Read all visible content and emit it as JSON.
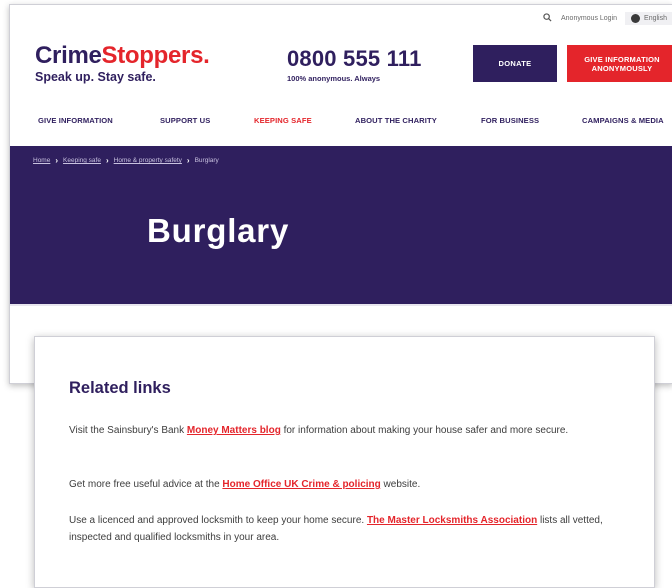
{
  "utility": {
    "login": "Anonymous Login",
    "language": "English"
  },
  "brand": {
    "name_part1": "Crime",
    "name_part2": "Stoppers.",
    "tagline": "Speak up. Stay safe.",
    "primary_color": "#2f1f5e",
    "accent_color": "#e4252b"
  },
  "phone": {
    "number": "0800 555 111",
    "subtitle": "100% anonymous. Always"
  },
  "buttons": {
    "donate": "DONATE",
    "give_info": "GIVE INFORMATION ANONYMOUSLY"
  },
  "nav": {
    "items": [
      {
        "label": "GIVE INFORMATION",
        "active": false
      },
      {
        "label": "SUPPORT US",
        "active": false
      },
      {
        "label": "KEEPING SAFE",
        "active": true
      },
      {
        "label": "ABOUT THE CHARITY",
        "active": false
      },
      {
        "label": "FOR BUSINESS",
        "active": false
      },
      {
        "label": "CAMPAIGNS & MEDIA",
        "active": false
      }
    ]
  },
  "breadcrumb": {
    "items": [
      "Home",
      "Keeping safe",
      "Home & property safety",
      "Burglary"
    ]
  },
  "page": {
    "title": "Burglary"
  },
  "related": {
    "heading": "Related links",
    "p1_before": "Visit the Sainsbury's Bank ",
    "p1_link": "Money Matters blog",
    "p1_after": " for information about making your house safer and more secure.",
    "p2_before": "Get more free useful advice at the ",
    "p2_link": "Home Office UK Crime & policing",
    "p2_after": " website.",
    "p3_before": "Use a licenced and approved locksmith to keep your home secure. ",
    "p3_link": "The Master Locksmiths Association",
    "p3_after": " lists all vetted, inspected and qualified locksmiths in your area."
  }
}
